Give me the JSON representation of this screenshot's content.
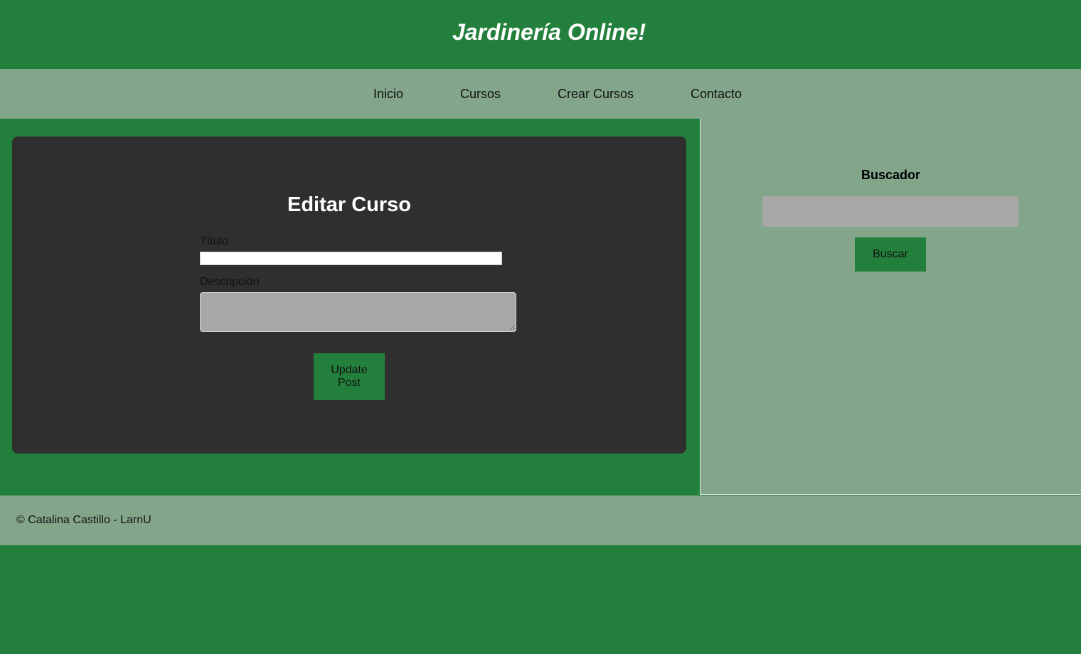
{
  "header": {
    "site_title": "Jardinería Online!"
  },
  "nav": {
    "items": [
      {
        "label": "Inicio"
      },
      {
        "label": "Cursos"
      },
      {
        "label": "Crear Cursos"
      },
      {
        "label": "Contacto"
      }
    ]
  },
  "edit_form": {
    "title": "Editar Curso",
    "titulo_label": "Título",
    "titulo_value": "",
    "descripcion_label": "Descripción",
    "descripcion_value": "",
    "submit_label": "Update Post"
  },
  "sidebar": {
    "title": "Buscador",
    "search_value": "",
    "search_button_label": "Buscar"
  },
  "footer": {
    "copyright": "© Catalina Castillo - LarnU"
  },
  "colors": {
    "primary_green": "#23803c",
    "sage": "#83a68b",
    "card_dark": "#2f2f2f",
    "input_gray": "#a9a7a8"
  }
}
